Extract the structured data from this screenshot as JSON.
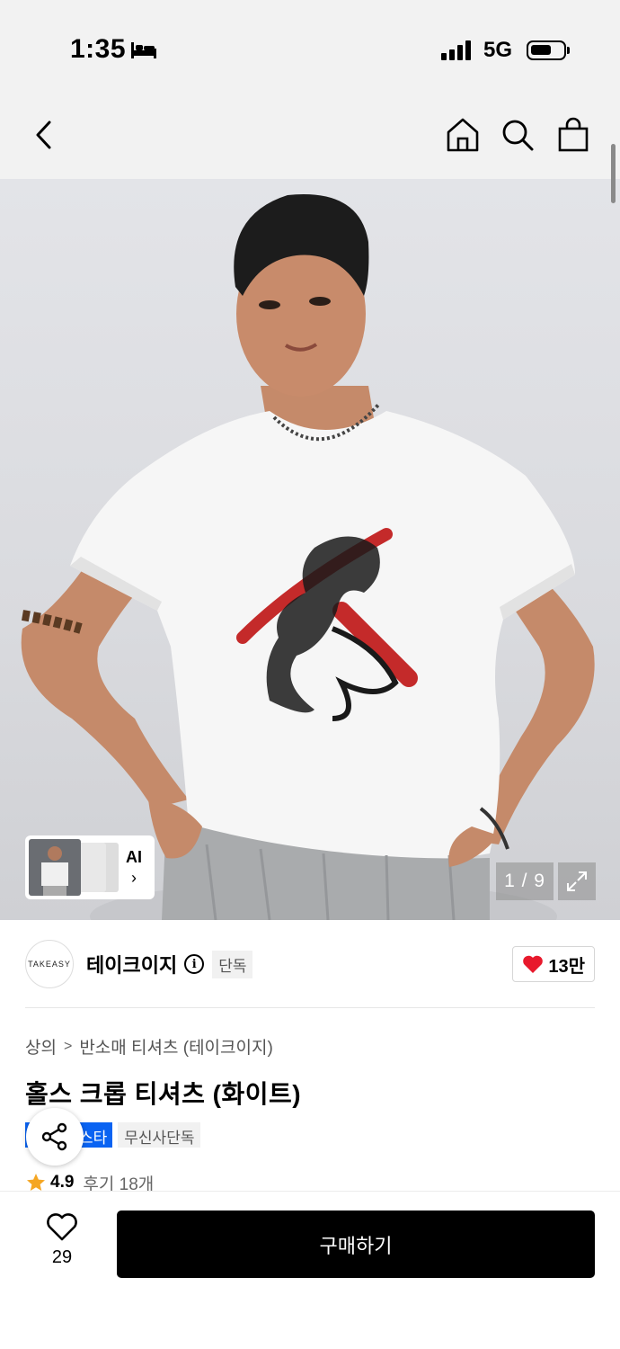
{
  "status_bar": {
    "time": "1:35",
    "network": "5G"
  },
  "nav": {
    "back_icon": "chevron-left-icon",
    "home_icon": "home-icon",
    "search_icon": "search-icon",
    "bag_icon": "shopping-bag-icon"
  },
  "gallery": {
    "ai_label": "AI",
    "ai_chevron": "›",
    "page_counter": "1 / 9",
    "expand_icon": "expand-icon"
  },
  "brand": {
    "logo_text": "TAKEASY",
    "name": "테이크이지",
    "info_icon": "i",
    "badge": "단독",
    "likes": "13만"
  },
  "breadcrumb": {
    "category": "상의",
    "separator": ">",
    "subcategory": "반소매 티셔츠 (테이크이지)"
  },
  "product": {
    "title": "홀스 크롭 티셔츠 (화이트)",
    "tags": [
      "스타",
      "무신사단독"
    ],
    "rating": "4.9",
    "reviews": "후기 18개"
  },
  "bottom": {
    "wish_count": "29",
    "buy_label": "구매하기"
  },
  "colors": {
    "accent_blue": "#0a63f2",
    "like_red": "#e8192c",
    "star": "#f5a623"
  }
}
